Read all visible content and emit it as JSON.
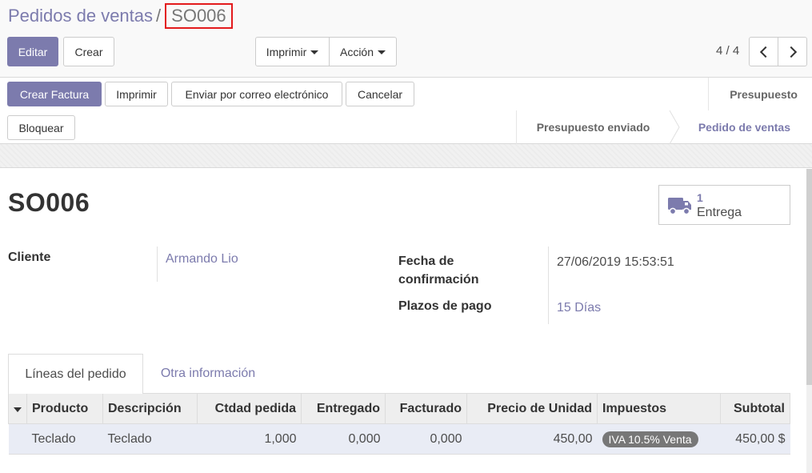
{
  "breadcrumb": {
    "parent": "Pedidos de ventas",
    "separator": "/",
    "current": "SO006"
  },
  "toolbar": {
    "edit_label": "Editar",
    "create_label": "Crear",
    "print_label": "Imprimir",
    "action_label": "Acción"
  },
  "pager": {
    "value": "4 / 4"
  },
  "header_buttons": {
    "create_invoice": "Crear Factura",
    "print": "Imprimir",
    "send_email": "Enviar por correo electrónico",
    "cancel": "Cancelar",
    "lock": "Bloquear"
  },
  "statusbar": {
    "stages": [
      "Presupuesto",
      "Presupuesto enviado",
      "Pedido de ventas"
    ],
    "active": "Pedido de ventas"
  },
  "record": {
    "name": "SO006"
  },
  "smart_button": {
    "value": "1",
    "label": "Entrega",
    "icon": "truck-icon"
  },
  "fields": {
    "customer_label": "Cliente",
    "customer_value": "Armando Lio",
    "confirmation_label_line1": "Fecha de",
    "confirmation_label_line2": "confirmación",
    "confirmation_value": "27/06/2019 15:53:51",
    "payment_terms_label": "Plazos de pago",
    "payment_terms_value": "15 Días"
  },
  "tabs": [
    {
      "label": "Líneas del pedido",
      "active": true
    },
    {
      "label": "Otra información",
      "active": false
    }
  ],
  "order_lines": {
    "columns": [
      "Producto",
      "Descripción",
      "Ctdad pedida",
      "Entregado",
      "Facturado",
      "Precio de Unidad",
      "Impuestos",
      "Subtotal"
    ],
    "rows": [
      {
        "product": "Teclado",
        "description": "Teclado",
        "qty": "1,000",
        "delivered": "0,000",
        "invoiced": "0,000",
        "price_unit": "450,00",
        "taxes": "IVA 10.5% Venta",
        "subtotal": "450,00 $"
      }
    ]
  },
  "colors": {
    "brand": "#7c7bad",
    "border_highlight": "#e31a1c",
    "badge": "#777777"
  }
}
